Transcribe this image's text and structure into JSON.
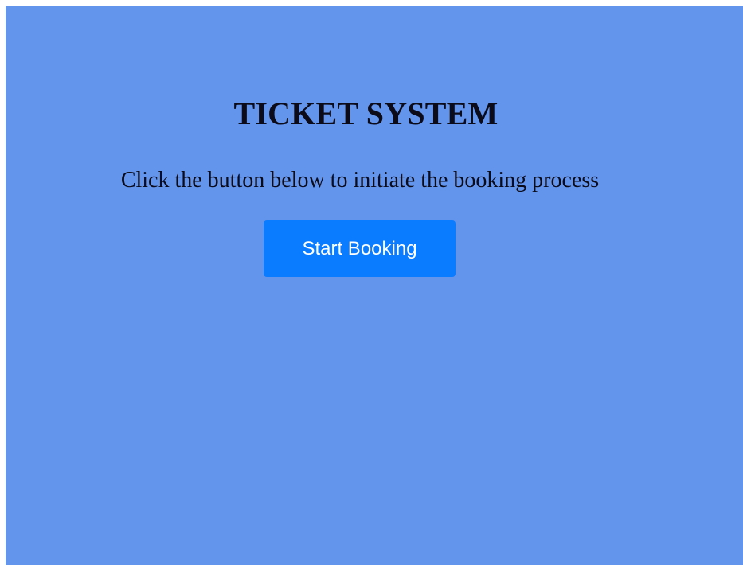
{
  "page": {
    "title": "TICKET SYSTEM",
    "subtitle": "Click the button below to initiate the booking process",
    "start_button_label": "Start Booking"
  },
  "colors": {
    "background": "#6495ed",
    "button": "#0a7cff",
    "button_text": "#ffffff",
    "text": "#0b0b1a"
  }
}
